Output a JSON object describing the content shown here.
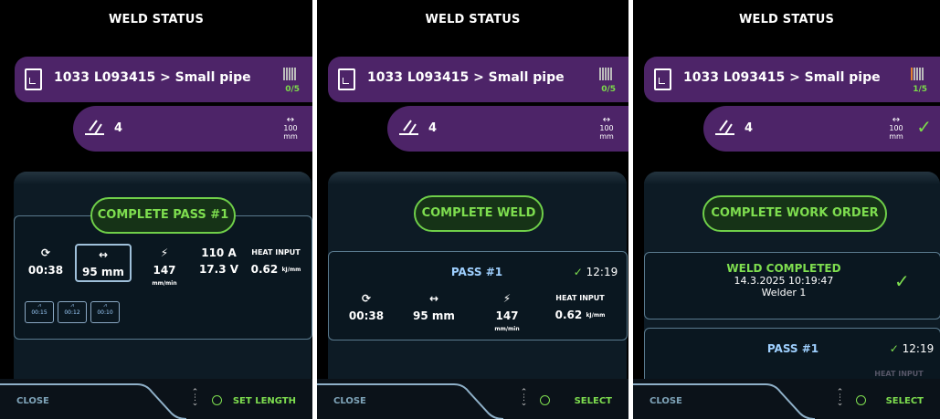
{
  "panels": [
    {
      "title": "WELD STATUS",
      "order": {
        "text": "1033 L093415 > Small pipe",
        "progress": "0/5"
      },
      "joint": {
        "number": "4",
        "length_value": "100",
        "length_unit": "mm",
        "check": ""
      },
      "button": "COMPLETE PASS #1",
      "metrics": {
        "time": "00:38",
        "length": "95 mm",
        "speed": "147",
        "current": "110 A",
        "voltage": "17.3 V",
        "heat_label": "HEAT INPUT",
        "heat_value": "0.62"
      },
      "history": [
        "00:15",
        "00:12",
        "00:10"
      ],
      "bottom": {
        "close": "CLOSE",
        "action": "SET LENGTH"
      }
    },
    {
      "title": "WELD STATUS",
      "order": {
        "text": "1033 L093415 > Small pipe",
        "progress": "0/5"
      },
      "joint": {
        "number": "4",
        "length_value": "100",
        "length_unit": "mm",
        "check": ""
      },
      "button": "COMPLETE WELD",
      "pass": {
        "title": "PASS #1",
        "time_done": "12:19",
        "time": "00:38",
        "length": "95 mm",
        "speed": "147",
        "heat_label": "HEAT INPUT",
        "heat_value": "0.62"
      },
      "bottom": {
        "close": "CLOSE",
        "action": "SELECT"
      }
    },
    {
      "title": "WELD STATUS",
      "order": {
        "text": "1033 L093415 > Small pipe",
        "progress": "1/5"
      },
      "joint": {
        "number": "4",
        "length_value": "100",
        "length_unit": "mm",
        "check": "✓"
      },
      "button": "COMPLETE WORK ORDER",
      "completed": {
        "title": "WELD COMPLETED",
        "datetime": "14.3.2025 10:19:47",
        "welder": "Welder 1"
      },
      "pass": {
        "title": "PASS #1",
        "time_done": "12:19",
        "partial": "HEAT INPUT"
      },
      "bottom": {
        "close": "CLOSE",
        "action": "SELECT"
      }
    }
  ],
  "units": {
    "speed": "mm/min",
    "heat": "kJ/mm"
  },
  "colors": {
    "accent_green": "#7ede4f",
    "purple": "#4d2468",
    "background": "#000000"
  }
}
